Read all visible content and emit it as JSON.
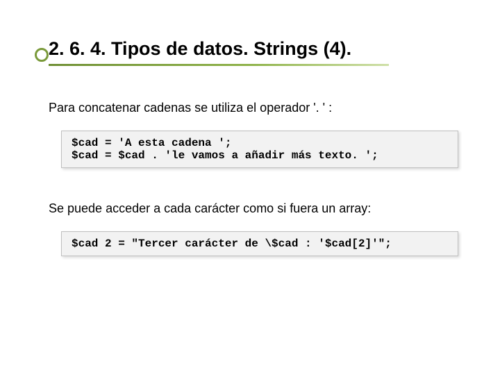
{
  "title": "2. 6. 4. Tipos de datos. Strings (4).",
  "para1": "Para concatenar cadenas se utiliza el operador '. ' :",
  "code1": "$cad = 'A esta cadena ';\n$cad = $cad . 'le vamos a añadir más texto. ';",
  "para2": "Se puede acceder a cada carácter como si fuera un array:",
  "code2": "$cad 2 = \"Tercer carácter de \\$cad : '$cad[2]'\";"
}
